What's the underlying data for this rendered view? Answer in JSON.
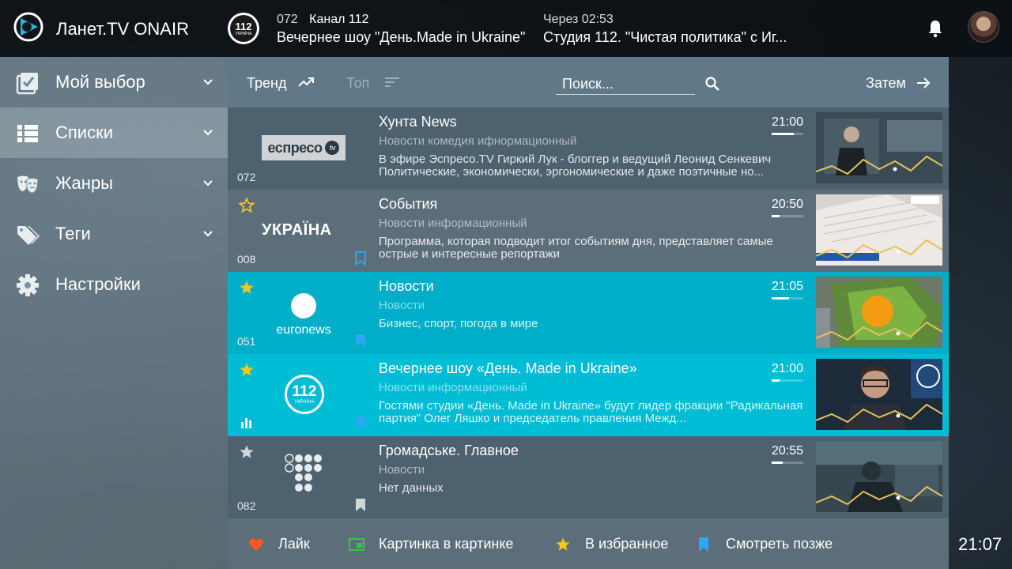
{
  "app": {
    "title": "Ланет.TV ONAIR"
  },
  "now": {
    "channel_logo_text": "112",
    "channel_logo_sub": "УКРАЇНА",
    "number": "072",
    "channel": "Канал 112",
    "show": "Вечернее шоу \"День.Made in Ukraine\""
  },
  "next": {
    "label": "Через 02:53",
    "show": "Студия 112. \"Чистая политика\" с Иг..."
  },
  "sidebar": {
    "items": [
      {
        "label": "Мой выбор",
        "icon": "checkbox-list-icon",
        "has_chevron": true,
        "active": false
      },
      {
        "label": "Списки",
        "icon": "list-icon",
        "has_chevron": true,
        "active": true
      },
      {
        "label": "Жанры",
        "icon": "theater-masks-icon",
        "has_chevron": true,
        "active": false
      },
      {
        "label": "Теги",
        "icon": "tags-icon",
        "has_chevron": true,
        "active": false
      },
      {
        "label": "Настройки",
        "icon": "gear-icon",
        "has_chevron": false,
        "active": false
      }
    ]
  },
  "toolbar": {
    "trend_label": "Тренд",
    "top_label": "Топ",
    "search_placeholder": "Поиск...",
    "then_label": "Затем"
  },
  "rows": [
    {
      "number": "072",
      "channel_logo": "espreso",
      "logo_text": "еспресо",
      "logo_badge": "tv",
      "starred": false,
      "show_star": false,
      "bookmarked": false,
      "show_bookmark": false,
      "title": "Хунта News",
      "genre": "Новости  комедия ифнормационный",
      "description": "В эфире Эспресо.TV Гиркий Лук - блоггер и ведущий Леонид Сенкевич Политические, экономически, эргономические и даже поэтичные но...",
      "time": "21:00",
      "progress": 0.7,
      "style": "dark"
    },
    {
      "number": "008",
      "channel_logo": "ukraina",
      "logo_text": "УКРАЇНА",
      "starred": false,
      "show_star": true,
      "bookmarked": false,
      "show_bookmark": true,
      "title": "События",
      "genre": "Новости информационный",
      "description": "Программа, которая подводит итог событиям дня, представляет самые острые и интересные репортажи",
      "time": "20:50",
      "progress": 0.25,
      "style": "dim"
    },
    {
      "number": "051",
      "channel_logo": "euronews",
      "logo_text": "euronews",
      "starred": true,
      "show_star": true,
      "bookmarked": true,
      "show_bookmark": true,
      "title": "Новости",
      "genre": "Новости",
      "description": "Бизнес, спорт, погода в мире",
      "time": "21:05",
      "progress": 0.55,
      "style": "hl"
    },
    {
      "number": "",
      "channel_logo": "112",
      "logo_text": "112",
      "logo_sub": "УКРАЇНА",
      "starred": true,
      "show_star": true,
      "bookmarked": true,
      "show_bookmark": true,
      "show_bars": true,
      "title": "Вечернее шоу «День. Made in Ukraine»",
      "genre": "Новости информационный",
      "description": "Гостями студии «День. Made in Ukraine» будут лидер фракции \"Радикальная партия\" Олег Ляшко и председатель правления Межд...",
      "time": "21:00",
      "progress": 0.25,
      "style": "hl2"
    },
    {
      "number": "082",
      "channel_logo": "hromadske",
      "starred": false,
      "show_star": true,
      "bookmarked": false,
      "show_bookmark": true,
      "title": "Громадське. Главное",
      "genre": "Новости",
      "description": "Нет данных",
      "time": "20:55",
      "progress": 0.35,
      "style": "dark"
    }
  ],
  "bottombar": {
    "like_label": "Лайк",
    "pip_label": "Картинка в картинке",
    "fav_label": "В избранное",
    "later_label": "Смотреть позже"
  },
  "clock": "21:07",
  "colors": {
    "highlight": "#00aec9",
    "highlight_alt": "#00bcd4",
    "star": "#f5c518",
    "bookmark": "#2aa8f0",
    "like": "#ff5722",
    "pip": "#2ecc40"
  }
}
